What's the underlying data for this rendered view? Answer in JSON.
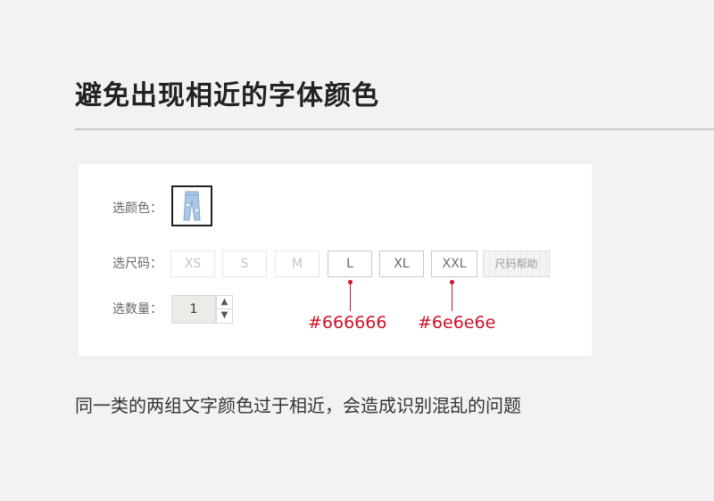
{
  "title": "避免出现相近的字体颜色",
  "product_options": {
    "color_label": "选颜色：",
    "size_label": "选尺码：",
    "quantity_label": "选数量：",
    "sizes": [
      {
        "label": "XS",
        "state": "disabled"
      },
      {
        "label": "S",
        "state": "disabled"
      },
      {
        "label": "M",
        "state": "disabled"
      },
      {
        "label": "L",
        "state": "available"
      },
      {
        "label": "XL",
        "state": "available"
      },
      {
        "label": "XXL",
        "state": "available"
      }
    ],
    "size_help_label": "尺码帮助",
    "quantity_value": "1",
    "quantity_up_icon": "chevron-up-icon",
    "quantity_down_icon": "chevron-down-icon"
  },
  "annotations": [
    {
      "text": "#666666",
      "color": "#666666"
    },
    {
      "text": "#6e6e6e",
      "color": "#6e6e6e"
    }
  ],
  "annotation_color": "#d0102a",
  "caption": "同一类的两组文字颜色过于相近，会造成识别混乱的问题"
}
